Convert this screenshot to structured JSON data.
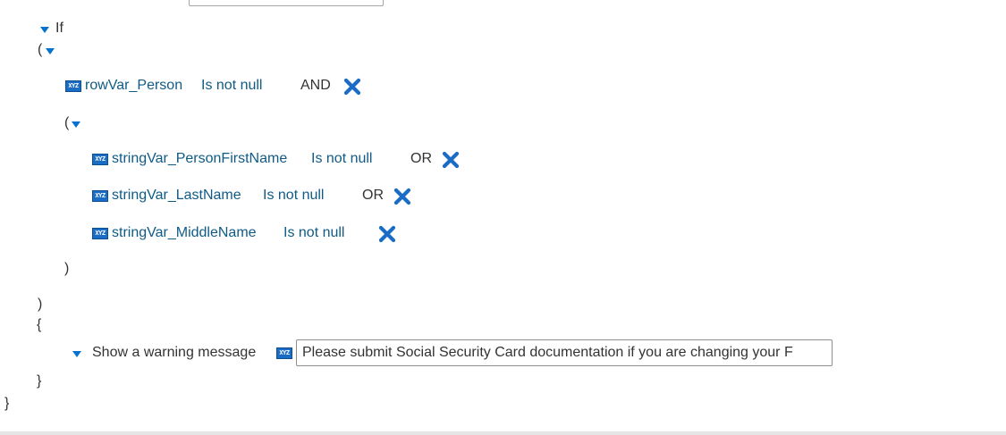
{
  "colors": {
    "accent": "#0572ce",
    "variable_text": "#0f5b86",
    "delete_icon": "#1b6cc4",
    "text": "#333333"
  },
  "icons": {
    "expand": "chevron-down-icon",
    "variable": "xyz-variable-icon",
    "delete": "close-icon"
  },
  "if_block": {
    "keyword": "If",
    "open_paren": "(",
    "close_paren": ")",
    "open_brace": "{",
    "close_brace": "}",
    "outer_close_brace": "}",
    "conditions": [
      {
        "variable": "rowVar_Person",
        "operator": "Is not null",
        "logic": "AND"
      }
    ],
    "group": {
      "open_paren": "(",
      "close_paren": ")",
      "conditions": [
        {
          "variable": "stringVar_PersonFirstName",
          "operator": "Is not null",
          "logic": "OR"
        },
        {
          "variable": "stringVar_LastName",
          "operator": "Is not null",
          "logic": "OR"
        },
        {
          "variable": "stringVar_MiddleName",
          "operator": "Is not null",
          "logic": ""
        }
      ]
    },
    "action": {
      "label": "Show a warning message",
      "value": "Please submit Social Security Card documentation if you are changing your F"
    }
  }
}
